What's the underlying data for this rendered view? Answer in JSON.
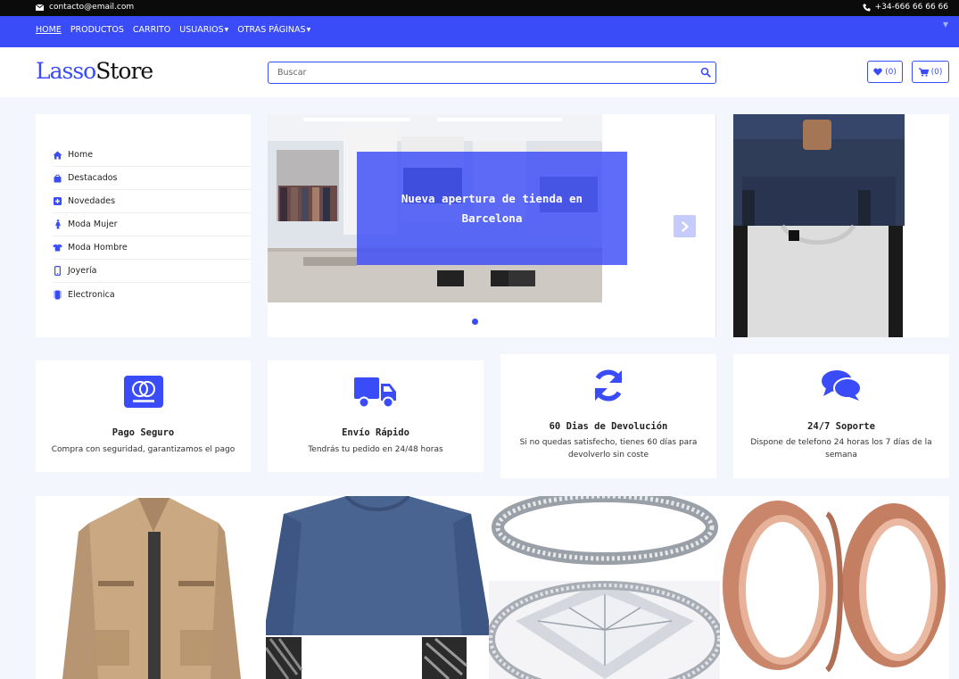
{
  "topbar": {
    "email": "contacto@email.com",
    "phone": "+34-666 66 66 66",
    "icons": {
      "email": "envelope-icon",
      "phone": "phone-icon"
    }
  },
  "nav": {
    "items": [
      {
        "label": "HOME",
        "active": true,
        "dropdown": false
      },
      {
        "label": "PRODUCTOS",
        "active": false,
        "dropdown": false
      },
      {
        "label": "CARRITO",
        "active": false,
        "dropdown": false
      },
      {
        "label": "USUARIOS",
        "active": false,
        "dropdown": true
      },
      {
        "label": "OTRAS PÁGINAS",
        "active": false,
        "dropdown": true
      }
    ]
  },
  "header": {
    "logo_part1": "Lasso",
    "logo_part2": "Store",
    "search_placeholder": "Buscar",
    "wishlist_count": "(0)",
    "cart_count": "(0)"
  },
  "sidebar": {
    "items": [
      {
        "label": "Home",
        "icon": "home-icon"
      },
      {
        "label": "Destacados",
        "icon": "shopping-bag-icon"
      },
      {
        "label": "Novedades",
        "icon": "plus-square-icon"
      },
      {
        "label": "Moda Mujer",
        "icon": "female-icon"
      },
      {
        "label": "Moda Hombre",
        "icon": "tshirt-icon"
      },
      {
        "label": "Joyería",
        "icon": "mobile-icon"
      },
      {
        "label": "Electronica",
        "icon": "microchip-icon"
      }
    ]
  },
  "carousel": {
    "caption": "Nueva apertura de tienda en Barcelona",
    "active_slide": 1
  },
  "features": [
    {
      "title": "Pago Seguro",
      "desc": "Compra con seguridad, garantizamos el pago",
      "icon": "mastercard-icon"
    },
    {
      "title": "Envío Rápido",
      "desc": "Tendrás tu pedido en 24/48 horas",
      "icon": "truck-icon"
    },
    {
      "title": "60 Dias de Devolución",
      "desc": "Si no quedas satisfecho, tienes 60 días para devolverlo sin coste",
      "icon": "sync-icon"
    },
    {
      "title": "24/7 Soporte",
      "desc": "Dispone de telefono 24 horas los 7 días de la semana",
      "icon": "comments-icon"
    }
  ],
  "colors": {
    "brand": "#3a4cf7",
    "topbar": "#0b0b0b",
    "background": "#f4f6fd"
  }
}
